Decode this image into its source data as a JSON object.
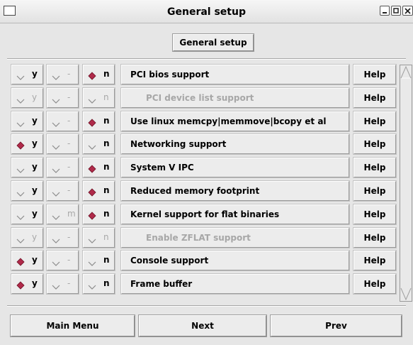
{
  "window": {
    "title": "General setup"
  },
  "header_button": "General setup",
  "help_label": "Help",
  "rows": [
    {
      "label": "PCI bios support",
      "y": "y",
      "m": "-",
      "n": "n",
      "selected": "n",
      "enabled": true,
      "indent": false
    },
    {
      "label": "PCI device list support",
      "y": "y",
      "m": "-",
      "n": "n",
      "selected": "none",
      "enabled": false,
      "indent": true
    },
    {
      "label": "Use linux memcpy|memmove|bcopy et al",
      "y": "y",
      "m": "-",
      "n": "n",
      "selected": "n",
      "enabled": true,
      "indent": false
    },
    {
      "label": "Networking support",
      "y": "y",
      "m": "-",
      "n": "n",
      "selected": "y",
      "enabled": true,
      "indent": false
    },
    {
      "label": "System V IPC",
      "y": "y",
      "m": "-",
      "n": "n",
      "selected": "n",
      "enabled": true,
      "indent": false
    },
    {
      "label": "Reduced memory footprint",
      "y": "y",
      "m": "-",
      "n": "n",
      "selected": "n",
      "enabled": true,
      "indent": false
    },
    {
      "label": "Kernel support for flat binaries",
      "y": "y",
      "m": "m",
      "n": "n",
      "selected": "n",
      "enabled": true,
      "indent": false
    },
    {
      "label": "Enable ZFLAT support",
      "y": "y",
      "m": "-",
      "n": "n",
      "selected": "none",
      "enabled": false,
      "indent": true
    },
    {
      "label": "Console support",
      "y": "y",
      "m": "-",
      "n": "n",
      "selected": "y",
      "enabled": true,
      "indent": false
    },
    {
      "label": "Frame buffer",
      "y": "y",
      "m": "-",
      "n": "n",
      "selected": "y",
      "enabled": true,
      "indent": false
    }
  ],
  "bottom_buttons": {
    "main_menu": "Main Menu",
    "next": "Next",
    "prev": "Prev"
  },
  "colors": {
    "selected_diamond": "#b02a4a",
    "disabled_text": "#a7a7a7"
  }
}
